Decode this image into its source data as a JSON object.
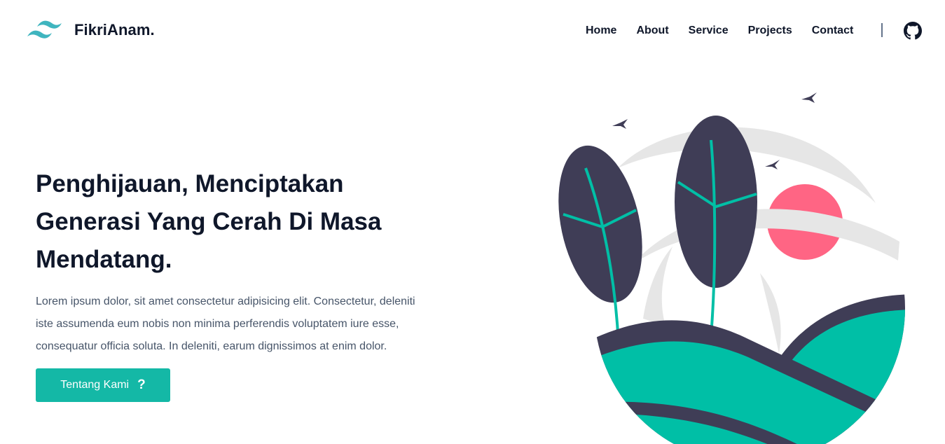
{
  "header": {
    "brand_name": "FikriAnam.",
    "logo_icon": "tailwind-wave-logo",
    "nav": [
      {
        "label": "Home"
      },
      {
        "label": "About"
      },
      {
        "label": "Service"
      },
      {
        "label": "Projects"
      },
      {
        "label": "Contact"
      }
    ],
    "github_icon": "github-icon"
  },
  "hero": {
    "title_lines": [
      "Penghijauan, Menciptakan",
      "Generasi Yang Cerah Di Masa",
      "Mendatang."
    ],
    "description_lines": [
      "Lorem ipsum dolor, sit amet consectetur adipisicing elit. Consectetur, deleniti",
      "iste assumenda eum nobis non minima perferendis voluptatem iure esse,",
      "consequatur officia soluta. In deleniti, earum dignissimos at enim dolor."
    ],
    "cta_label": "Tentang Kami",
    "cta_icon": "?"
  },
  "colors": {
    "accent": "#14b8a6",
    "illustration_green": "#00bfa6",
    "illustration_dark": "#3f3d56",
    "illustration_sun": "#ff6584",
    "illustration_grey": "#e6e6e6",
    "text_dark": "#0f172a",
    "text_muted": "#475569"
  }
}
